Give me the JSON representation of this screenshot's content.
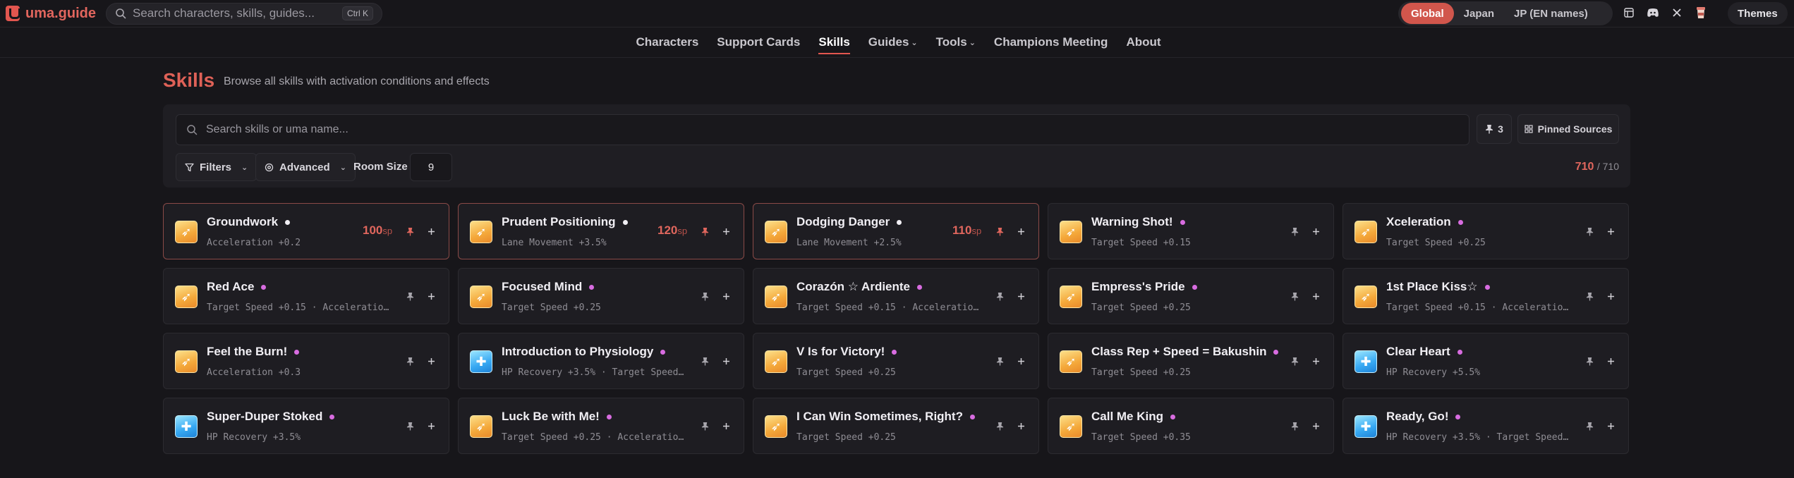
{
  "app": {
    "name": "uma.guide"
  },
  "header": {
    "search_placeholder": "Search characters, skills, guides...",
    "search_shortcut": "Ctrl K",
    "regions": [
      "Global",
      "Japan",
      "JP (EN names)"
    ],
    "active_region": "Global",
    "themes_label": "Themes"
  },
  "nav": {
    "items": [
      {
        "label": "Characters"
      },
      {
        "label": "Support Cards"
      },
      {
        "label": "Skills"
      },
      {
        "label": "Guides"
      },
      {
        "label": "Tools"
      },
      {
        "label": "Champions Meeting"
      },
      {
        "label": "About"
      }
    ],
    "active": "Skills"
  },
  "page": {
    "title": "Skills",
    "subtitle": "Browse all skills with activation conditions and effects"
  },
  "filters": {
    "search_placeholder": "Search skills or uma name...",
    "pinned_count": "3",
    "pinned_sources_label": "Pinned Sources",
    "filters_label": "Filters",
    "advanced_label": "Advanced",
    "room_size_label": "Room Size",
    "room_size_value": "9",
    "shown_count": "710",
    "total_count": "/ 710"
  },
  "skills": [
    {
      "name": "Groundwork",
      "effect": "Acceleration +0.2",
      "cost": "100",
      "cost_unit": "sp",
      "pinned": true,
      "dot": "white",
      "icon": "yellow"
    },
    {
      "name": "Prudent Positioning",
      "effect": "Lane Movement +3.5%",
      "cost": "120",
      "cost_unit": "sp",
      "pinned": true,
      "dot": "white",
      "icon": "yellow"
    },
    {
      "name": "Dodging Danger",
      "effect": "Lane Movement +2.5%",
      "cost": "110",
      "cost_unit": "sp",
      "pinned": true,
      "dot": "white",
      "icon": "yellow"
    },
    {
      "name": "Warning Shot!",
      "effect": "Target Speed +0.15",
      "cost": "",
      "cost_unit": "",
      "pinned": false,
      "dot": "pink",
      "icon": "yellow"
    },
    {
      "name": "Xceleration",
      "effect": "Target Speed +0.25",
      "cost": "",
      "cost_unit": "",
      "pinned": false,
      "dot": "pink",
      "icon": "yellow"
    },
    {
      "name": "Red Ace",
      "effect": "Target Speed +0.15 · Acceleration ...",
      "cost": "",
      "cost_unit": "",
      "pinned": false,
      "dot": "pink",
      "icon": "yellow"
    },
    {
      "name": "Focused Mind",
      "effect": "Target Speed +0.25",
      "cost": "",
      "cost_unit": "",
      "pinned": false,
      "dot": "pink",
      "icon": "yellow"
    },
    {
      "name": "Corazón ☆ Ardiente",
      "effect": "Target Speed +0.15 · Acceleration ...",
      "cost": "",
      "cost_unit": "",
      "pinned": false,
      "dot": "pink",
      "icon": "yellow"
    },
    {
      "name": "Empress's Pride",
      "effect": "Target Speed +0.25",
      "cost": "",
      "cost_unit": "",
      "pinned": false,
      "dot": "pink",
      "icon": "yellow"
    },
    {
      "name": "1st Place Kiss☆",
      "effect": "Target Speed +0.15 · Acceleration ...",
      "cost": "",
      "cost_unit": "",
      "pinned": false,
      "dot": "pink",
      "icon": "yellow"
    },
    {
      "name": "Feel the Burn!",
      "effect": "Acceleration +0.3",
      "cost": "",
      "cost_unit": "",
      "pinned": false,
      "dot": "pink",
      "icon": "yellow"
    },
    {
      "name": "Introduction to Physiology",
      "effect": "HP Recovery +3.5% · Target Speed +...",
      "cost": "",
      "cost_unit": "",
      "pinned": false,
      "dot": "pink",
      "icon": "blue"
    },
    {
      "name": "V Is for Victory!",
      "effect": "Target Speed +0.25",
      "cost": "",
      "cost_unit": "",
      "pinned": false,
      "dot": "pink",
      "icon": "yellow"
    },
    {
      "name": "Class Rep + Speed = Bakushin",
      "effect": "Target Speed +0.25",
      "cost": "",
      "cost_unit": "",
      "pinned": false,
      "dot": "pink",
      "icon": "yellow"
    },
    {
      "name": "Clear Heart",
      "effect": "HP Recovery +5.5%",
      "cost": "",
      "cost_unit": "",
      "pinned": false,
      "dot": "pink",
      "icon": "blue"
    },
    {
      "name": "Super-Duper Stoked",
      "effect": "HP Recovery +3.5%",
      "cost": "",
      "cost_unit": "",
      "pinned": false,
      "dot": "pink",
      "icon": "blue"
    },
    {
      "name": "Luck Be with Me!",
      "effect": "Target Speed +0.25 · Acceleration ...",
      "cost": "",
      "cost_unit": "",
      "pinned": false,
      "dot": "pink",
      "icon": "yellow"
    },
    {
      "name": "I Can Win Sometimes, Right?",
      "effect": "Target Speed +0.25",
      "cost": "",
      "cost_unit": "",
      "pinned": false,
      "dot": "pink",
      "icon": "yellow"
    },
    {
      "name": "Call Me King",
      "effect": "Target Speed +0.35",
      "cost": "",
      "cost_unit": "",
      "pinned": false,
      "dot": "pink",
      "icon": "yellow"
    },
    {
      "name": "Ready, Go!",
      "effect": "HP Recovery +3.5% · Target Speed +...",
      "cost": "",
      "cost_unit": "",
      "pinned": false,
      "dot": "pink",
      "icon": "blue"
    }
  ],
  "colors": {
    "accent": "#e2564f",
    "background": "#17161a",
    "card": "#1e1d22",
    "pinned_border": "#8a4a47",
    "dot_pink": "#d86ce0"
  }
}
